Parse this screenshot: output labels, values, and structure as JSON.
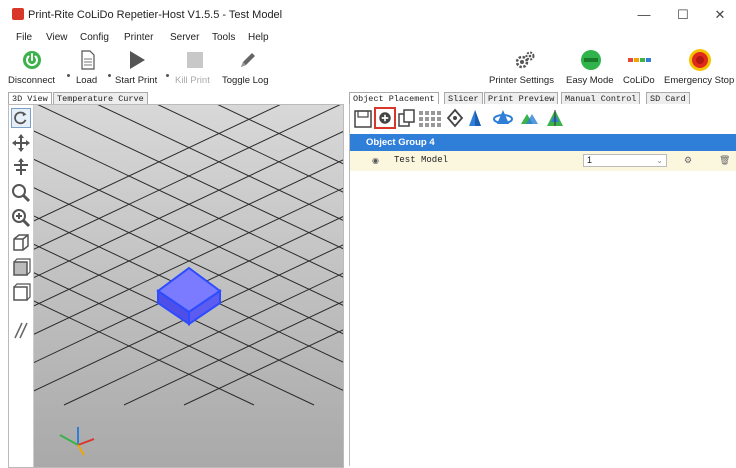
{
  "window": {
    "title": "Print-Rite CoLiDo Repetier-Host V1.5.5 - Test Model",
    "minimize": "—",
    "maximize": "☐",
    "close": "✕"
  },
  "menu": [
    "File",
    "View",
    "Config",
    "Printer",
    "Server",
    "Tools",
    "Help"
  ],
  "toolbar": {
    "disconnect": "Disconnect",
    "load": "Load",
    "start_print": "Start Print",
    "kill_print": "Kill Print",
    "toggle_log": "Toggle Log",
    "printer_settings": "Printer Settings",
    "easy_mode": "Easy Mode",
    "colido": "CoLiDo",
    "emergency_stop": "Emergency Stop"
  },
  "left_tabs": [
    "3D View",
    "Temperature Curve"
  ],
  "right_tabs": [
    "Object Placement",
    "Slicer",
    "Print Preview",
    "Manual Control",
    "SD Card"
  ],
  "object_placement": {
    "group_name": "Object Group 4",
    "model_name": "Test Model",
    "copies": "1"
  },
  "colors": {
    "accent": "#2f7fd9",
    "highlight": "#d9362b",
    "model": "#6b6bff",
    "row_bg": "#fbf7df"
  }
}
